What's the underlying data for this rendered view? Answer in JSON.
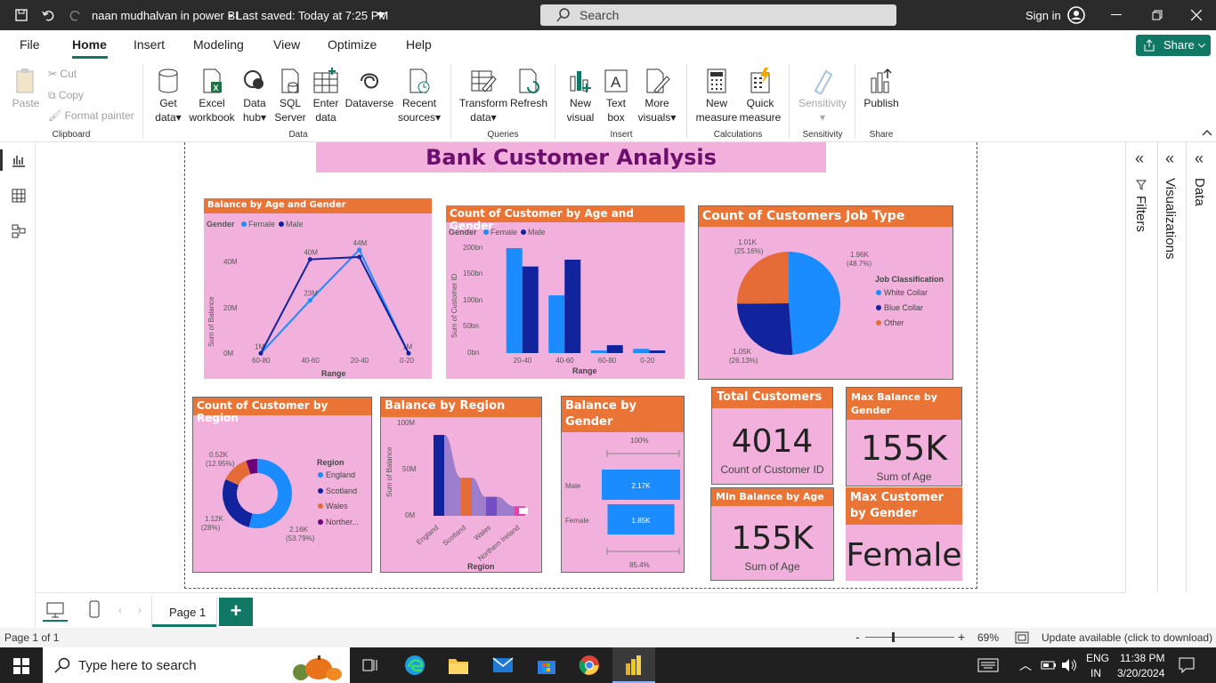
{
  "window": {
    "doc_title": "naan mudhalvan in power BI",
    "saved_status": "• Last saved: Today at 7:25 PM",
    "search_placeholder": "Search",
    "sign_in": "Sign in"
  },
  "tabs": [
    "File",
    "Home",
    "Insert",
    "Modeling",
    "View",
    "Optimize",
    "Help"
  ],
  "share_label": "Share",
  "ribbon": {
    "clipboard": {
      "paste": "Paste",
      "cut": "Cut",
      "copy": "Copy",
      "format_painter": "Format painter",
      "group": "Clipboard"
    },
    "data": {
      "get_data_1": "Get",
      "get_data_2": "data",
      "excel_1": "Excel",
      "excel_2": "workbook",
      "hub_1": "Data",
      "hub_2": "hub",
      "sql_1": "SQL",
      "sql_2": "Server",
      "enter_1": "Enter",
      "enter_2": "data",
      "dataverse": "Dataverse",
      "recent_1": "Recent",
      "recent_2": "sources",
      "group": "Data"
    },
    "queries": {
      "transform_1": "Transform",
      "transform_2": "data",
      "refresh": "Refresh",
      "group": "Queries"
    },
    "insert": {
      "new_visual_1": "New",
      "new_visual_2": "visual",
      "text_box_1": "Text",
      "text_box_2": "box",
      "more_1": "More",
      "more_2": "visuals",
      "group": "Insert"
    },
    "calc": {
      "new_measure_1": "New",
      "new_measure_2": "measure",
      "quick_1": "Quick",
      "quick_2": "measure",
      "group": "Calculations"
    },
    "sensitivity": {
      "label": "Sensitivity",
      "group": "Sensitivity"
    },
    "share": {
      "publish": "Publish",
      "group": "Share"
    }
  },
  "side_panels": {
    "filters": "Filters",
    "visualizations": "Visualizations",
    "data": "Data"
  },
  "report_title": "Bank Customer Analysis",
  "visuals": {
    "balance_age_gender": {
      "title": "Balance by Age and Gender",
      "legend_title": "Gender",
      "legend": [
        "Female",
        "Male"
      ],
      "ylabel": "Sum of Balance",
      "xlabel": "Range",
      "yticks": [
        "40M",
        "20M",
        "0M"
      ]
    },
    "count_age_gender": {
      "title": "Count of Customer by Age and Gender",
      "legend_title": "Gender",
      "legend": [
        "Female",
        "Male"
      ],
      "ylabel": "Sum of Customer ID",
      "xlabel": "Range",
      "yticks": [
        "200bn",
        "150bn",
        "100bn",
        "50bn",
        "0bn"
      ]
    },
    "job_type": {
      "title": "Count of Customers Job Type",
      "legend_title": "Job Classification",
      "legend": [
        "White Collar",
        "Blue Collar",
        "Other"
      ]
    },
    "region_count": {
      "title": "Count of Customer by Region",
      "legend_title": "Region",
      "legend": [
        "England",
        "Scotland",
        "Wales",
        "Norther..."
      ]
    },
    "balance_region": {
      "title": "Balance by Region",
      "ylabel": "Sum of Balance",
      "xlabel": "Region",
      "yticks": [
        "100M",
        "50M",
        "0M"
      ]
    },
    "balance_gender": {
      "title": "Balance by Gender",
      "top_label": "100%",
      "bottom_label": "85.4%"
    },
    "total_customers": {
      "title": "Total Customers",
      "value": "4014",
      "caption": "Count of Customer ID"
    },
    "max_balance_gender": {
      "title": "Max Balance by Gender",
      "value": "155K",
      "caption": "Sum of Age"
    },
    "min_balance_age": {
      "title": "Min Balance by Age",
      "value": "155K",
      "caption": "Sum of Age"
    },
    "max_customer_gender": {
      "title": "Max Customer by Gender",
      "value": "Female"
    }
  },
  "colors": {
    "female": "#1a8cff",
    "male": "#12239e",
    "other": "#e66c37",
    "purple": "#6b007b",
    "header": "#ea7436",
    "card": "#f2b1dc",
    "title_text": "#6b0f6b"
  },
  "chart_data": [
    {
      "type": "line",
      "title": "Balance by Age and Gender",
      "xlabel": "Range",
      "ylabel": "Sum of Balance",
      "categories": [
        "60-80",
        "40-60",
        "20-40",
        "0-20"
      ],
      "series": [
        {
          "name": "Female",
          "values": [
            1,
            23,
            44,
            1
          ],
          "labels": [
            "1M",
            "23M",
            "44M",
            "1M"
          ]
        },
        {
          "name": "Male",
          "values": [
            1,
            40,
            41,
            1
          ],
          "labels": [
            "",
            "40M",
            "",
            ""
          ]
        }
      ],
      "ylim": [
        0,
        48
      ]
    },
    {
      "type": "bar",
      "title": "Count of Customer by Age and Gender",
      "xlabel": "Range",
      "ylabel": "Sum of Customer ID",
      "categories": [
        "20-40",
        "40-60",
        "60-80",
        "0-20"
      ],
      "series": [
        {
          "name": "Female",
          "values": [
            200,
            110,
            5,
            8
          ]
        },
        {
          "name": "Male",
          "values": [
            165,
            178,
            15,
            5
          ]
        }
      ],
      "ylim": [
        0,
        200
      ]
    },
    {
      "type": "pie",
      "title": "Count of Customers Job Type",
      "slices": [
        {
          "label": "White Collar",
          "value": 1.96,
          "text": "1.96K",
          "pct": "(48.7%)"
        },
        {
          "label": "Blue Collar",
          "value": 1.05,
          "text": "1.05K",
          "pct": "(26.13%)"
        },
        {
          "label": "Other",
          "value": 1.01,
          "text": "1.01K",
          "pct": "(25.16%)"
        }
      ]
    },
    {
      "type": "pie",
      "title": "Count of Customer by Region",
      "slices": [
        {
          "label": "England",
          "value": 2.16,
          "text": "2.16K",
          "pct": "(53.79%)"
        },
        {
          "label": "Scotland",
          "value": 1.12,
          "text": "1.12K",
          "pct": "(28%)"
        },
        {
          "label": "Wales",
          "value": 0.52,
          "text": "0.52K",
          "pct": "(12.95%)"
        },
        {
          "label": "Norther...",
          "value": 0.21,
          "text": "",
          "pct": ""
        }
      ]
    },
    {
      "type": "bar",
      "title": "Balance by Region",
      "xlabel": "Region",
      "ylabel": "Sum of Balance",
      "categories": [
        "England",
        "Scotland",
        "Wales",
        "Northern Ireland"
      ],
      "values": [
        85,
        40,
        20,
        10
      ],
      "ylim": [
        0,
        100
      ]
    },
    {
      "type": "bar",
      "title": "Balance by Gender",
      "categories": [
        "Male",
        "Female"
      ],
      "values": [
        2.17,
        1.85
      ],
      "labels": [
        "2.17K",
        "1.85K"
      ]
    }
  ],
  "pages": {
    "page1": "Page 1",
    "add": "+"
  },
  "status": {
    "page_of": "Page 1 of 1",
    "zoom": "69%",
    "update": "Update available (click to download)"
  },
  "taskbar": {
    "search": "Type here to search",
    "lang_1": "ENG",
    "lang_2": "IN",
    "time": "11:38 PM",
    "date": "3/20/2024"
  }
}
